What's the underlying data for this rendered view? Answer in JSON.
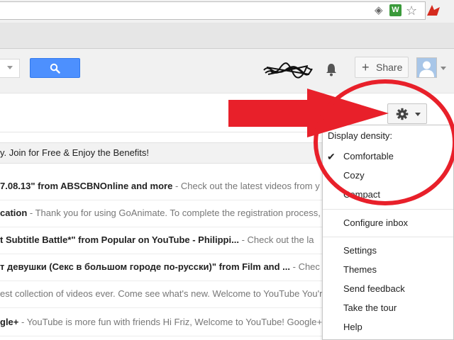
{
  "browser": {
    "address_icons": [
      "page-action-icon",
      "shield-extension-icon",
      "star-icon",
      "antivirus-extension-icon"
    ]
  },
  "header": {
    "share_label": "Share",
    "share_plus": "+"
  },
  "mail": {
    "promo": "y. Join for Free & Enjoy the Benefits!",
    "rows": [
      {
        "subject": "7.08.13\" from ABSCBNOnline and more",
        "snippet": " - Check out the latest videos from y"
      },
      {
        "subject": "cation",
        "snippet": " - Thank you for using GoAnimate. To complete the registration process,"
      },
      {
        "subject": "t Subtitle Battle*\" from Popular on YouTube - Philippi...",
        "snippet": " - Check out the la"
      },
      {
        "subject": "т девушки (Секс в большом городе по-русски)\" from Film and ...",
        "snippet": " - Chec"
      },
      {
        "subject": "",
        "snippet": "est collection of videos ever. Come see what's new. Welcome to YouTube You'r"
      },
      {
        "subject": "gle+",
        "snippet": " - YouTube is more fun with friends Hi Friz, Welcome to YouTube! Google+"
      }
    ]
  },
  "settings_menu": {
    "density_heading": "Display density:",
    "check_mark": "✔",
    "density_options": [
      "Comfortable",
      "Cozy",
      "Compact"
    ],
    "selected_density": "Comfortable",
    "configure_inbox": "Configure inbox",
    "items": [
      "Settings",
      "Themes",
      "Send feedback",
      "Take the tour",
      "Help"
    ]
  },
  "colors": {
    "search_button": "#4d90fe",
    "annotation_red": "#e8202a"
  }
}
